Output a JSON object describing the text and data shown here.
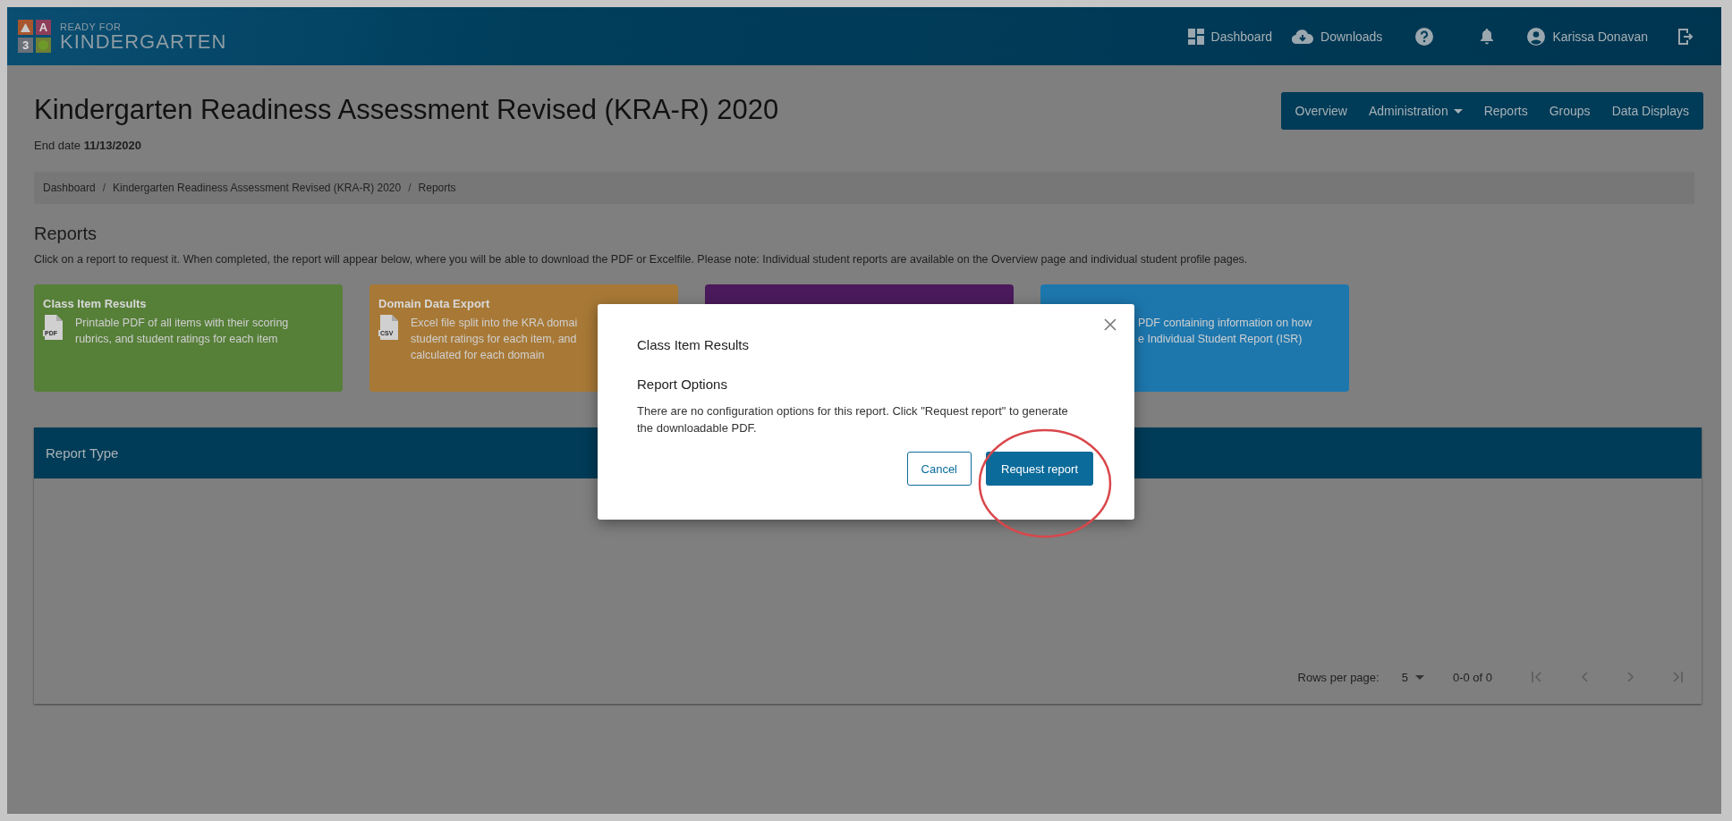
{
  "logo": {
    "letters": [
      "A",
      "3"
    ],
    "line1": "READY FOR",
    "line2": "KINDERGARTEN"
  },
  "top_nav": [
    {
      "label": "Dashboard",
      "kind": "dashboard"
    },
    {
      "label": "Downloads",
      "kind": "download"
    },
    {
      "kind": "help"
    },
    {
      "kind": "bell"
    },
    {
      "label": "Karissa Donavan",
      "kind": "user"
    },
    {
      "kind": "logout"
    }
  ],
  "page": {
    "title": "Kindergarten Readiness Assessment Revised (KRA-R) 2020",
    "end_date_label": "End date",
    "end_date": "11/13/2020"
  },
  "tabs": [
    {
      "label": "Overview",
      "dropdown": false
    },
    {
      "label": "Administration",
      "dropdown": true
    },
    {
      "label": "Reports",
      "dropdown": false
    },
    {
      "label": "Groups",
      "dropdown": false
    },
    {
      "label": "Data Displays",
      "dropdown": false
    }
  ],
  "breadcrumb": [
    {
      "text": "Dashboard",
      "kind": "link"
    },
    {
      "text": "/",
      "kind": "separator"
    },
    {
      "text": "Kindergarten Readiness Assessment Revised (KRA-R) 2020",
      "kind": "link"
    },
    {
      "text": "/",
      "kind": "separator"
    },
    {
      "text": "Reports",
      "kind": "link"
    }
  ],
  "section": {
    "title": "Reports",
    "description": "Click on a report to request it. When completed, the report will appear below, where you will be able to download the PDF or Excelfile. Please note: Individual student reports are available on the Overview page and individual student profile pages."
  },
  "cards": [
    {
      "title": "Class Item Results",
      "file_type": "PDF",
      "lines": [
        "Printable PDF of all items with their scoring",
        "rubrics, and student ratings for each item"
      ],
      "color": "#567f38"
    },
    {
      "title": "Domain Data Export",
      "file_type": "CSV",
      "lines": [
        "Excel file split into the KRA domai",
        "student ratings for each item, and",
        "calculated for each domain"
      ],
      "color": "#a87936"
    },
    {
      "color": "#4b1a5c"
    },
    {
      "lines": [
        "PDF containing information on how",
        "e Individual Student Report (ISR)"
      ],
      "color": "#1d77ad"
    }
  ],
  "table": {
    "header": "Report Type",
    "rows_per_page_label": "Rows per page:",
    "rows_per_page": "5",
    "range": "0-0 of 0"
  },
  "modal": {
    "title": "Class Item Results",
    "subtitle": "Report Options",
    "text": "There are no configuration options for this report. Click \"Request report\" to generate the downloadable PDF.",
    "buttons": [
      {
        "label": "Cancel",
        "kind": "secondary"
      },
      {
        "label": "Request report",
        "kind": "primary"
      }
    ],
    "highlighted": true
  }
}
